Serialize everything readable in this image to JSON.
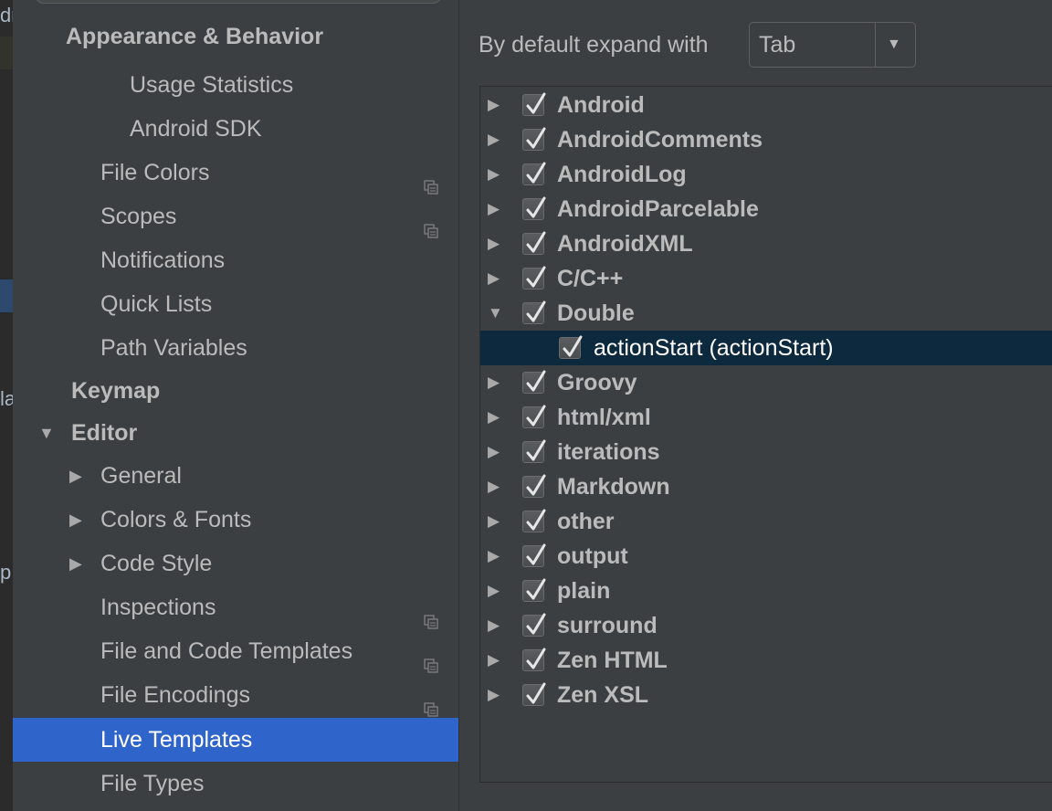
{
  "editor_fragments": [
    "dr",
    "la",
    "p"
  ],
  "sidebar": {
    "items": [
      {
        "label": "Appearance & Behavior",
        "bold": true,
        "indent": 58,
        "arrow": "",
        "project_icon": false
      },
      {
        "label": "Usage Statistics",
        "indent": 128,
        "arrow": "",
        "project_icon": false
      },
      {
        "label": "Android SDK",
        "indent": 128,
        "arrow": "",
        "project_icon": false
      },
      {
        "label": "File Colors",
        "indent": 96,
        "arrow": "",
        "project_icon": true
      },
      {
        "label": "Scopes",
        "indent": 96,
        "arrow": "",
        "project_icon": true
      },
      {
        "label": "Notifications",
        "indent": 96,
        "arrow": "",
        "project_icon": false
      },
      {
        "label": "Quick Lists",
        "indent": 96,
        "arrow": "",
        "project_icon": false
      },
      {
        "label": "Path Variables",
        "indent": 96,
        "arrow": "",
        "project_icon": false
      },
      {
        "label": "Keymap",
        "bold": true,
        "indent": 64,
        "arrow": "",
        "project_icon": false
      },
      {
        "label": "Editor",
        "bold": true,
        "indent": 64,
        "arrow": "▼",
        "project_icon": false
      },
      {
        "label": "General",
        "indent": 96,
        "arrow": "▶",
        "project_icon": false
      },
      {
        "label": "Colors & Fonts",
        "indent": 96,
        "arrow": "▶",
        "project_icon": false
      },
      {
        "label": "Code Style",
        "indent": 96,
        "arrow": "▶",
        "project_icon": false
      },
      {
        "label": "Inspections",
        "indent": 96,
        "arrow": "",
        "project_icon": true
      },
      {
        "label": "File and Code Templates",
        "indent": 96,
        "arrow": "",
        "project_icon": true
      },
      {
        "label": "File Encodings",
        "indent": 96,
        "arrow": "",
        "project_icon": true
      },
      {
        "label": "Live Templates",
        "indent": 96,
        "arrow": "",
        "project_icon": false,
        "selected": true
      },
      {
        "label": "File Types",
        "indent": 96,
        "arrow": "",
        "project_icon": false
      }
    ]
  },
  "content": {
    "expand_label": "By default expand with",
    "expand_value": "Tab",
    "templates": [
      {
        "label": "Android",
        "group": true,
        "expanded": false,
        "checked": true
      },
      {
        "label": "AndroidComments",
        "group": true,
        "expanded": false,
        "checked": true
      },
      {
        "label": "AndroidLog",
        "group": true,
        "expanded": false,
        "checked": true
      },
      {
        "label": "AndroidParcelable",
        "group": true,
        "expanded": false,
        "checked": true
      },
      {
        "label": "AndroidXML",
        "group": true,
        "expanded": false,
        "checked": true
      },
      {
        "label": "C/C++",
        "group": true,
        "expanded": false,
        "checked": true
      },
      {
        "label": "Double",
        "group": true,
        "expanded": true,
        "checked": true
      },
      {
        "label": "actionStart (actionStart)",
        "group": false,
        "checked": true,
        "selected": true
      },
      {
        "label": "Groovy",
        "group": true,
        "expanded": false,
        "checked": true
      },
      {
        "label": "html/xml",
        "group": true,
        "expanded": false,
        "checked": true
      },
      {
        "label": "iterations",
        "group": true,
        "expanded": false,
        "checked": true
      },
      {
        "label": "Markdown",
        "group": true,
        "expanded": false,
        "checked": true
      },
      {
        "label": "other",
        "group": true,
        "expanded": false,
        "checked": true
      },
      {
        "label": "output",
        "group": true,
        "expanded": false,
        "checked": true
      },
      {
        "label": "plain",
        "group": true,
        "expanded": false,
        "checked": true
      },
      {
        "label": "surround",
        "group": true,
        "expanded": false,
        "checked": true
      },
      {
        "label": "Zen HTML",
        "group": true,
        "expanded": false,
        "checked": true
      },
      {
        "label": "Zen XSL",
        "group": true,
        "expanded": false,
        "checked": true
      }
    ]
  }
}
